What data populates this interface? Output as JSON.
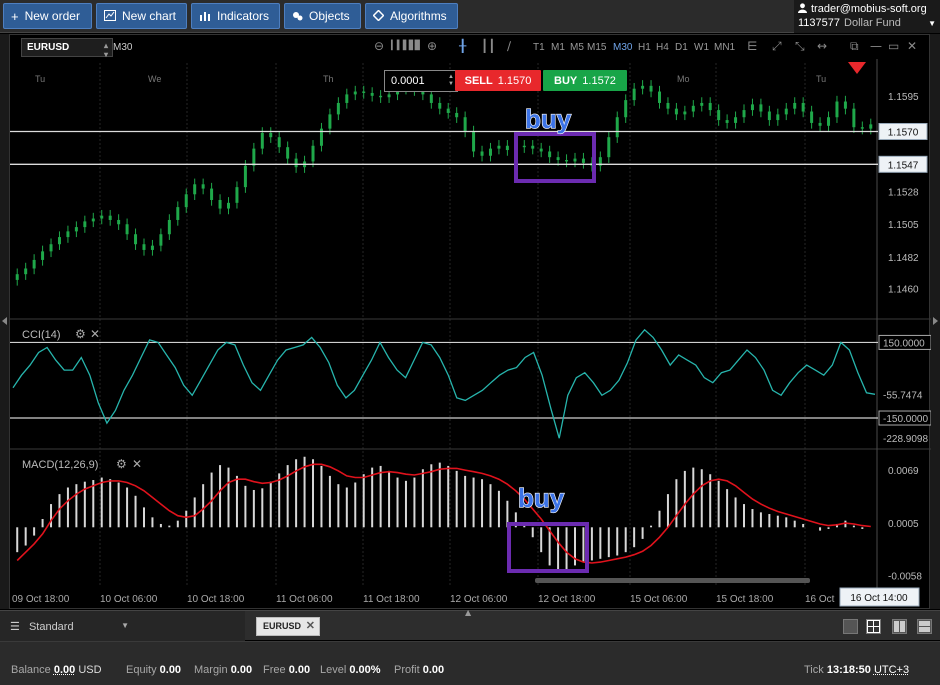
{
  "toolbar": {
    "new_order": "New order",
    "new_chart": "New chart",
    "indicators": "Indicators",
    "objects": "Objects",
    "algorithms": "Algorithms"
  },
  "account": {
    "email": "trader@mobius-soft.org",
    "id": "1137577",
    "fund": "Dollar Fund"
  },
  "chart_toolbar": {
    "symbol": "EURUSD",
    "timeframe_current": "M30",
    "timeframes": [
      "T1",
      "M1",
      "M5",
      "M15",
      "M30",
      "H1",
      "H4",
      "D1",
      "W1",
      "MN1"
    ],
    "selected_timeframe": "M30"
  },
  "trade_panel": {
    "lot": "0.0001",
    "sell_label": "SELL",
    "sell_price": "1.1570",
    "buy_label": "BUY",
    "buy_price": "1.1572"
  },
  "chart_data": [
    {
      "type": "candlestick",
      "symbol": "EURUSD",
      "timeframe": "M30",
      "day_labels": [
        "Tu",
        "We",
        "Th",
        "Mo",
        "Tu"
      ],
      "price_ticks": [
        "1.1595",
        "1.1570",
        "1.1547",
        "1.1528",
        "1.1505",
        "1.1482",
        "1.1460"
      ],
      "horizontal_lines": [
        1.157,
        1.1547
      ],
      "highlighted_price": "1.1570",
      "highlighted_price_2": "1.1547",
      "annotation": "buy",
      "close_series": [
        1.147,
        1.1474,
        1.148,
        1.1486,
        1.1491,
        1.1496,
        1.15,
        1.1503,
        1.1507,
        1.1509,
        1.1511,
        1.1508,
        1.1505,
        1.1498,
        1.1491,
        1.1487,
        1.149,
        1.1498,
        1.1508,
        1.1517,
        1.1526,
        1.1533,
        1.153,
        1.1522,
        1.1516,
        1.152,
        1.1531,
        1.1546,
        1.1558,
        1.1569,
        1.1566,
        1.1559,
        1.1551,
        1.1545,
        1.1549,
        1.156,
        1.1572,
        1.1582,
        1.159,
        1.1596,
        1.1598,
        1.1597,
        1.1595,
        1.1594,
        1.1596,
        1.16,
        1.1601,
        1.1599,
        1.1596,
        1.159,
        1.1586,
        1.1583,
        1.158,
        1.157,
        1.1556,
        1.1553,
        1.1558,
        1.156,
        1.1557,
        1.1559,
        1.156,
        1.1558,
        1.1556,
        1.1552,
        1.155,
        1.1549,
        1.1551,
        1.1548,
        1.1546,
        1.1552,
        1.1566,
        1.158,
        1.1592,
        1.16,
        1.1602,
        1.1598,
        1.159,
        1.1586,
        1.1582,
        1.1584,
        1.1588,
        1.159,
        1.1585,
        1.1578,
        1.1576,
        1.158,
        1.1585,
        1.1589,
        1.1584,
        1.1578,
        1.1582,
        1.1586,
        1.159,
        1.1584,
        1.1576,
        1.1574,
        1.158,
        1.1591,
        1.1586,
        1.1573,
        1.1572,
        1.1575
      ]
    },
    {
      "type": "line",
      "name": "CCI(14)",
      "ticks": [
        "150.0000",
        "-55.7474",
        "-150.0000",
        "-228.9098"
      ],
      "levels": [
        150,
        -150
      ],
      "last_value": "-55.7474",
      "values": [
        -30,
        20,
        60,
        110,
        130,
        80,
        40,
        40,
        90,
        20,
        -90,
        -170,
        -120,
        -40,
        20,
        90,
        160,
        150,
        100,
        50,
        -20,
        -60,
        0,
        60,
        120,
        150,
        140,
        60,
        -10,
        -40,
        20,
        80,
        120,
        130,
        140,
        170,
        130,
        70,
        -20,
        -70,
        -40,
        20,
        80,
        150,
        90,
        40,
        10,
        80,
        150,
        140,
        90,
        20,
        -70,
        -80,
        -60,
        -40,
        -10,
        20,
        40,
        50,
        90,
        110,
        20,
        -110,
        -230,
        -60,
        10,
        30,
        -10,
        -60,
        -40,
        0,
        70,
        160,
        200,
        170,
        120,
        60,
        100,
        80,
        60,
        10,
        -10,
        30,
        40,
        80,
        120,
        90,
        40,
        -40,
        -60,
        -10,
        30,
        60,
        40,
        20,
        60,
        150,
        120,
        30,
        -50,
        -55.7474
      ]
    },
    {
      "type": "bar",
      "name": "MACD(12,26,9)",
      "ticks": [
        "0.0069",
        "0.0005",
        "-0.0058"
      ],
      "annotation": "buy",
      "time_ticks": [
        "09 Oct 18:00",
        "10 Oct 06:00",
        "10 Oct 18:00",
        "11 Oct 06:00",
        "11 Oct 18:00",
        "12 Oct 06:00",
        "12 Oct 18:00",
        "15 Oct 06:00",
        "15 Oct 18:00",
        "16 Oct"
      ],
      "cursor_time": "16 Oct 14:00",
      "histogram": [
        -0.003,
        -0.0022,
        -0.001,
        0.001,
        0.0028,
        0.004,
        0.0048,
        0.0052,
        0.0055,
        0.0057,
        0.006,
        0.0058,
        0.0054,
        0.0048,
        0.0038,
        0.0024,
        0.0012,
        0.0004,
        0.0002,
        0.0008,
        0.002,
        0.0036,
        0.0052,
        0.0066,
        0.0075,
        0.0072,
        0.0062,
        0.005,
        0.0045,
        0.0047,
        0.0055,
        0.0065,
        0.0075,
        0.0082,
        0.0085,
        0.0082,
        0.0074,
        0.0062,
        0.0052,
        0.0048,
        0.0054,
        0.0064,
        0.0072,
        0.0074,
        0.0068,
        0.006,
        0.0056,
        0.006,
        0.007,
        0.0076,
        0.0078,
        0.0074,
        0.0068,
        0.0062,
        0.006,
        0.0058,
        0.0052,
        0.0044,
        0.0032,
        0.0018,
        0.0004,
        -0.0012,
        -0.003,
        -0.0046,
        -0.0055,
        -0.0052,
        -0.0046,
        -0.0042,
        -0.004,
        -0.0038,
        -0.0036,
        -0.0034,
        -0.003,
        -0.0024,
        -0.0014,
        0.0002,
        0.002,
        0.004,
        0.0058,
        0.0068,
        0.0072,
        0.007,
        0.0064,
        0.0056,
        0.0046,
        0.0036,
        0.0028,
        0.0022,
        0.0018,
        0.0016,
        0.0014,
        0.0012,
        0.0008,
        0.0004,
        0.0,
        -0.0004,
        -0.0002,
        0.0004,
        0.0008,
        0.0002,
        -0.0002,
        0.0
      ],
      "signal": [
        -0.004,
        -0.003,
        -0.002,
        -0.0008,
        0.0008,
        0.0022,
        0.0032,
        0.004,
        0.0046,
        0.005,
        0.0054,
        0.0056,
        0.0056,
        0.0054,
        0.005,
        0.0044,
        0.0036,
        0.0028,
        0.002,
        0.0014,
        0.0012,
        0.0014,
        0.0022,
        0.0032,
        0.0044,
        0.0054,
        0.0058,
        0.0058,
        0.0055,
        0.0053,
        0.0054,
        0.0057,
        0.0062,
        0.0068,
        0.0073,
        0.0076,
        0.0076,
        0.0073,
        0.0068,
        0.0062,
        0.006,
        0.006,
        0.0063,
        0.0066,
        0.0067,
        0.0066,
        0.0064,
        0.0063,
        0.0065,
        0.0067,
        0.007,
        0.0071,
        0.0071,
        0.0069,
        0.0067,
        0.0065,
        0.0062,
        0.0058,
        0.0052,
        0.0044,
        0.0034,
        0.0022,
        0.001,
        -0.0004,
        -0.0018,
        -0.003,
        -0.0038,
        -0.0042,
        -0.0043,
        -0.0042,
        -0.004,
        -0.0038,
        -0.0036,
        -0.0033,
        -0.0029,
        -0.0022,
        -0.0012,
        0.0,
        0.0014,
        0.0028,
        0.004,
        0.005,
        0.0056,
        0.0058,
        0.0056,
        0.005,
        0.0042,
        0.0034,
        0.0028,
        0.0023,
        0.0019,
        0.0016,
        0.0013,
        0.001,
        0.0007,
        0.0004,
        0.0002,
        0.0003,
        0.0005,
        0.0004,
        0.0002,
        0.0001
      ]
    }
  ],
  "panes": {
    "cci_label": "CCI(14)",
    "macd_label": "MACD(12,26,9)"
  },
  "tabs": {
    "workspace": "Standard",
    "symbol_tab": "EURUSD"
  },
  "status": {
    "balance_label": "Balance",
    "balance_value": "0.00",
    "balance_currency": "USD",
    "equity_label": "Equity",
    "equity_value": "0.00",
    "margin_label": "Margin",
    "margin_value": "0.00",
    "free_label": "Free",
    "free_value": "0.00",
    "level_label": "Level",
    "level_value": "0.00%",
    "profit_label": "Profit",
    "profit_value": "0.00",
    "tick_label": "Tick",
    "tick_time": "13:18:50",
    "timezone": "UTC+3"
  },
  "colors": {
    "accent": "#2f5d96",
    "candle": "#1fa84a",
    "cci_line": "#27b5ad",
    "macd_signal": "#e0121c",
    "annotation_box": "#6b2bb0",
    "sell": "#e8282c",
    "buy": "#18a548"
  }
}
